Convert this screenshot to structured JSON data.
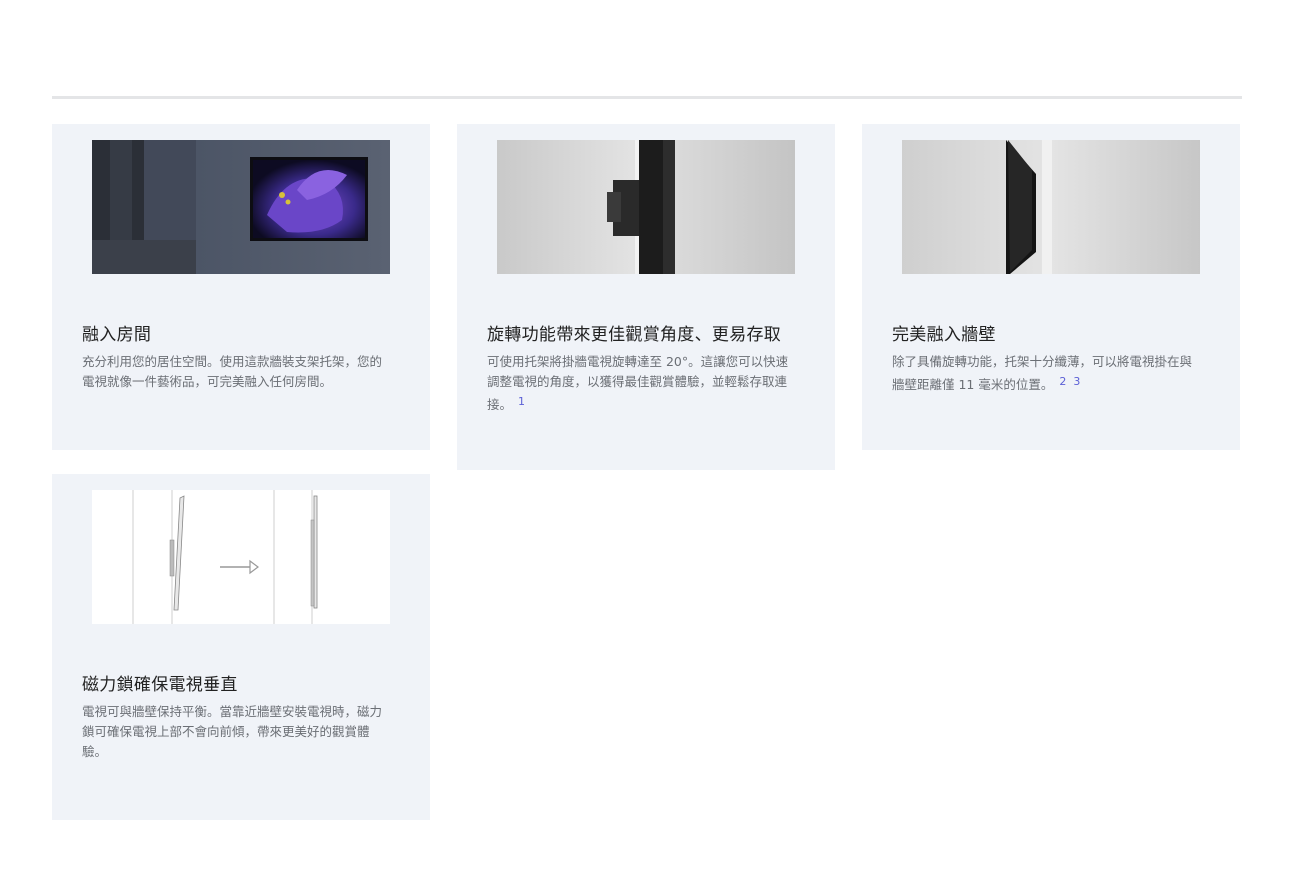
{
  "features": [
    {
      "title": "融入房間",
      "description": "充分利用您的居住空間。使用這款牆裝支架托架，您的電視就像一件藝術品，可完美融入任何房間。",
      "footnotes": "",
      "image": "tv-in-room-photo"
    },
    {
      "title": "旋轉功能帶來更佳觀賞角度、更易存取",
      "description": "可使用托架將掛牆電視旋轉達至 20°。這讓您可以快速調整電視的角度，以獲得最佳觀賞體驗，並輕鬆存取連接。",
      "footnotes": "1",
      "image": "swivel-bracket-photo"
    },
    {
      "title": "完美融入牆壁",
      "description": "除了具備旋轉功能，托架十分纖薄，可以將電視掛在與牆壁距離僅 11 毫米的位置。",
      "footnotes": "2  3",
      "image": "slim-wall-mount-photo"
    },
    {
      "title": "磁力鎖確保電視垂直",
      "description": "電視可與牆壁保持平衡。當靠近牆壁安裝電視時，磁力鎖可確保電視上部不會向前傾，帶來更美好的觀賞體驗。",
      "footnotes": "",
      "image": "magnetic-lock-diagram"
    }
  ],
  "colors": {
    "card_bg": "#f0f3f8",
    "title": "#222222",
    "description": "#6b6f75",
    "footnote_link": "#5b5fd6",
    "divider": "#e4e5e7"
  }
}
